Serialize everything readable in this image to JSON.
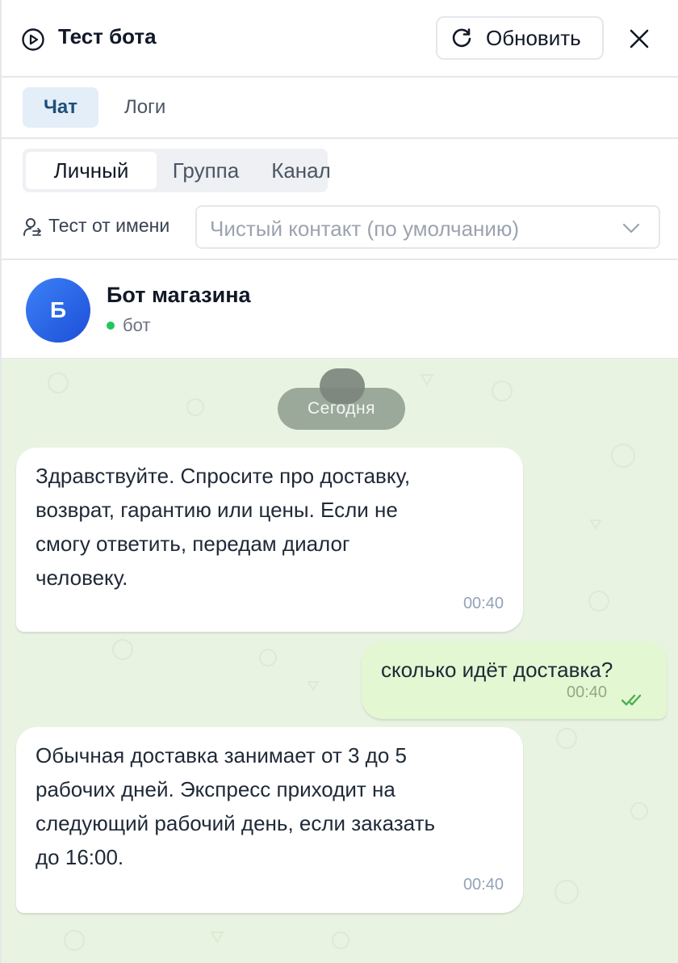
{
  "header": {
    "title": "Тест бота",
    "refresh_label": "Обновить"
  },
  "tabs": [
    {
      "label": "Чат",
      "active": true
    },
    {
      "label": "Логи",
      "active": false
    }
  ],
  "chat_type": {
    "options": [
      "Личный",
      "Группа",
      "Канал"
    ],
    "selected": "Личный"
  },
  "test_as": {
    "label": "Тест от имени",
    "placeholder": "Чистый контакт (по умолчанию)"
  },
  "bot": {
    "avatar_letter": "Б",
    "name": "Бот магазина",
    "status": "бот"
  },
  "chat": {
    "date_label": "Сегодня",
    "messages": [
      {
        "direction": "incoming",
        "text": "Здравствуйте. Спросите про доставку,\nвозврат, гарантию или цены. Если не\nсмогу ответить, передам диалог\nчеловеку.",
        "time": "00:40"
      },
      {
        "direction": "outgoing",
        "text": "сколько идёт доставка?",
        "time": "00:40",
        "read": true
      },
      {
        "direction": "incoming",
        "text": "Обычная доставка занимает от 3 до 5\nрабочих дней. Экспресс приходит на\nследующий рабочий день, если заказать\nдо 16:00.",
        "time": "00:40"
      }
    ]
  },
  "colors": {
    "accent": "#1e4f7a",
    "chat_background": "#e9f3e2",
    "outgoing_bubble": "#e3f7d2",
    "online": "#22c55e",
    "avatar": "#2563eb"
  }
}
